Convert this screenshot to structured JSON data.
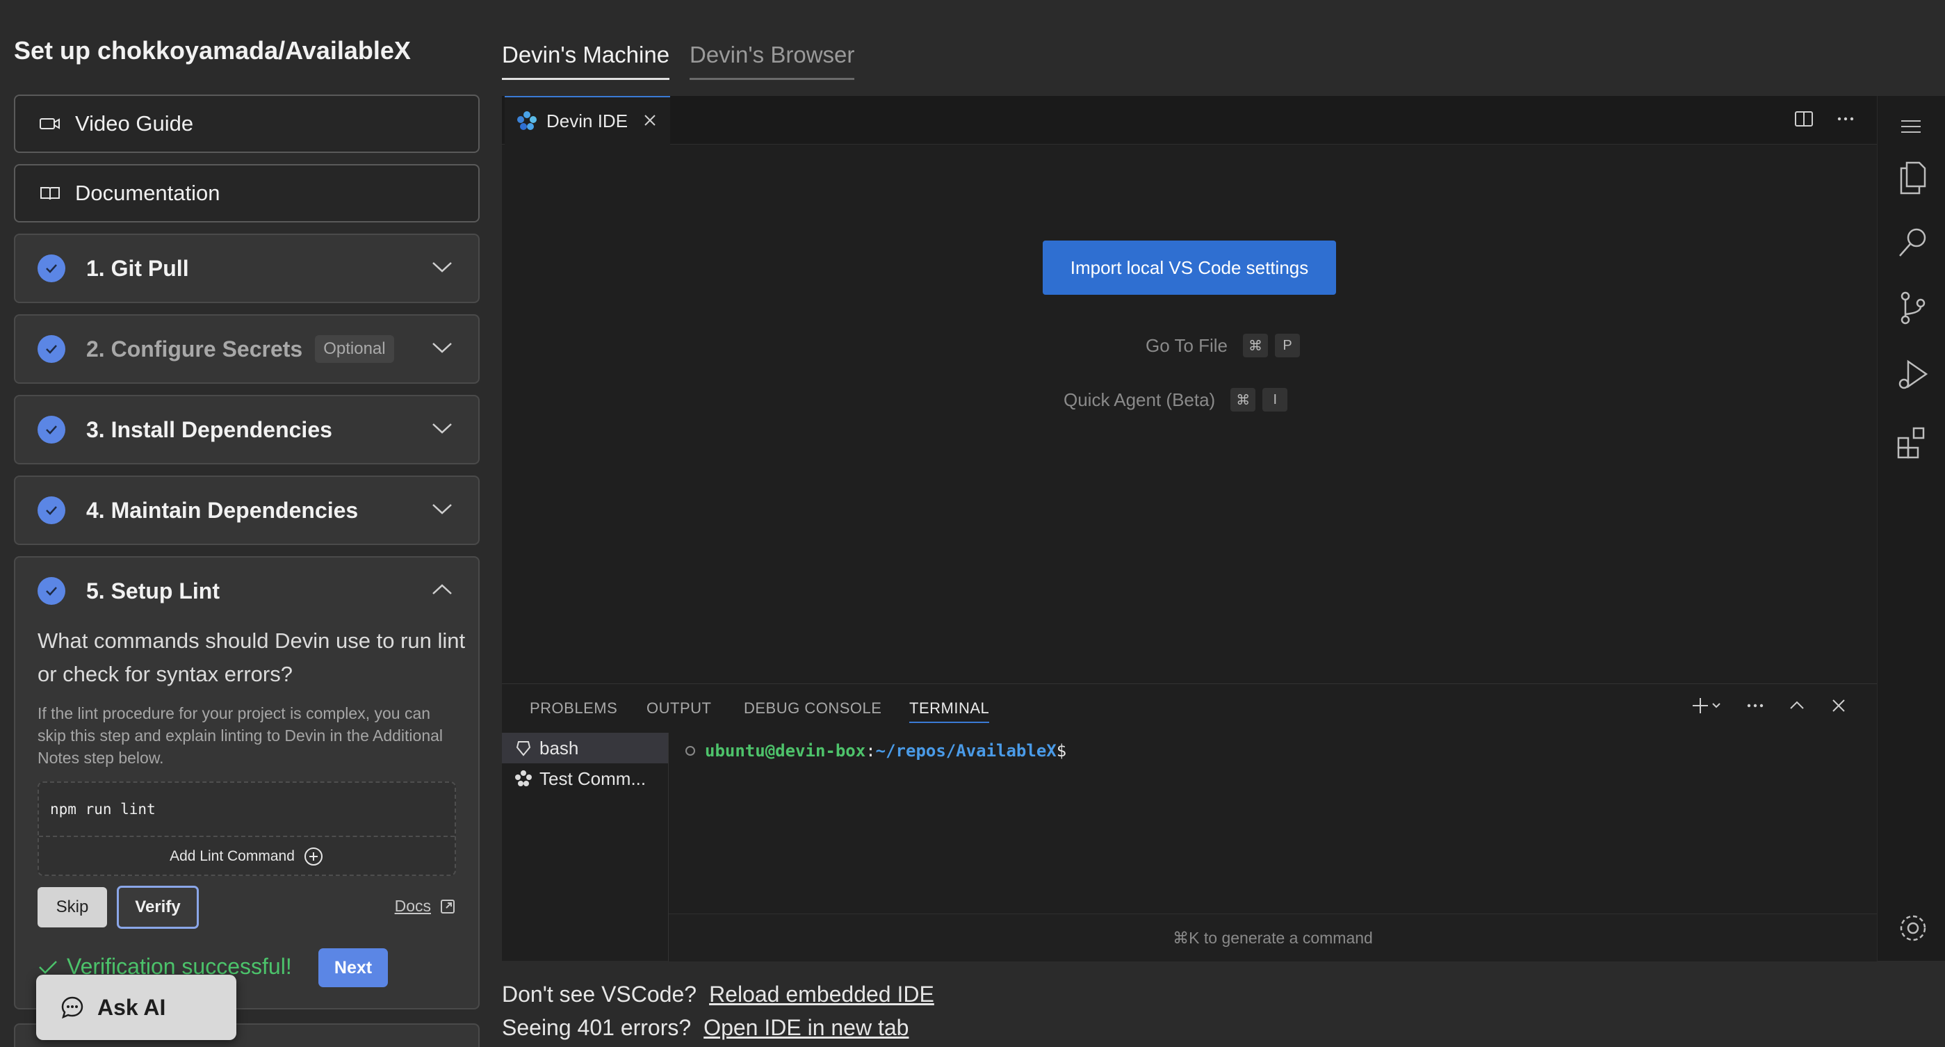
{
  "page_title": "Set up chokkoyamada/AvailableX",
  "links": {
    "video_guide": "Video Guide",
    "documentation": "Documentation"
  },
  "steps": [
    {
      "title": "1. Git Pull"
    },
    {
      "title": "2. Configure Secrets",
      "badge": "Optional"
    },
    {
      "title": "3. Install Dependencies"
    },
    {
      "title": "4. Maintain Dependencies"
    },
    {
      "title": "5. Setup Lint"
    }
  ],
  "lint": {
    "question": "What commands should Devin use to run lint or check for syntax errors?",
    "hint": "If the lint procedure for your project is complex, you can skip this step and explain linting to Devin in the Additional Notes step below.",
    "command": "npm run lint",
    "add_command": "Add Lint Command",
    "skip": "Skip",
    "verify": "Verify",
    "docs": "Docs",
    "success": "Verification successful!",
    "next": "Next"
  },
  "ask_ai": "Ask AI",
  "top_tabs": [
    "Devin's Machine",
    "Devin's Browser"
  ],
  "ide": {
    "tab_label": "Devin IDE",
    "import_button": "Import local VS Code settings",
    "shortcuts": [
      {
        "label": "Go To File",
        "keys": [
          "⌘",
          "P"
        ]
      },
      {
        "label": "Quick Agent (Beta)",
        "keys": [
          "⌘",
          "I"
        ]
      }
    ],
    "panel_tabs": [
      "PROBLEMS",
      "OUTPUT",
      "DEBUG CONSOLE",
      "TERMINAL"
    ],
    "terminals": [
      "bash",
      "Test Comm..."
    ],
    "prompt_user": "ubuntu@devin-box",
    "prompt_sep": ":",
    "prompt_path": "~/repos/AvailableX",
    "prompt_end": "$",
    "cmdk_hint": "⌘K to generate a command"
  },
  "footer": {
    "line1_text": "Don't see VSCode?",
    "line1_link": "Reload embedded IDE",
    "line2_text": "Seeing 401 errors?",
    "line2_link": "Open IDE in new tab"
  },
  "colors": {
    "accent": "#5b86e5",
    "success": "#4cc36b",
    "ide_button": "#2f6fd1"
  }
}
